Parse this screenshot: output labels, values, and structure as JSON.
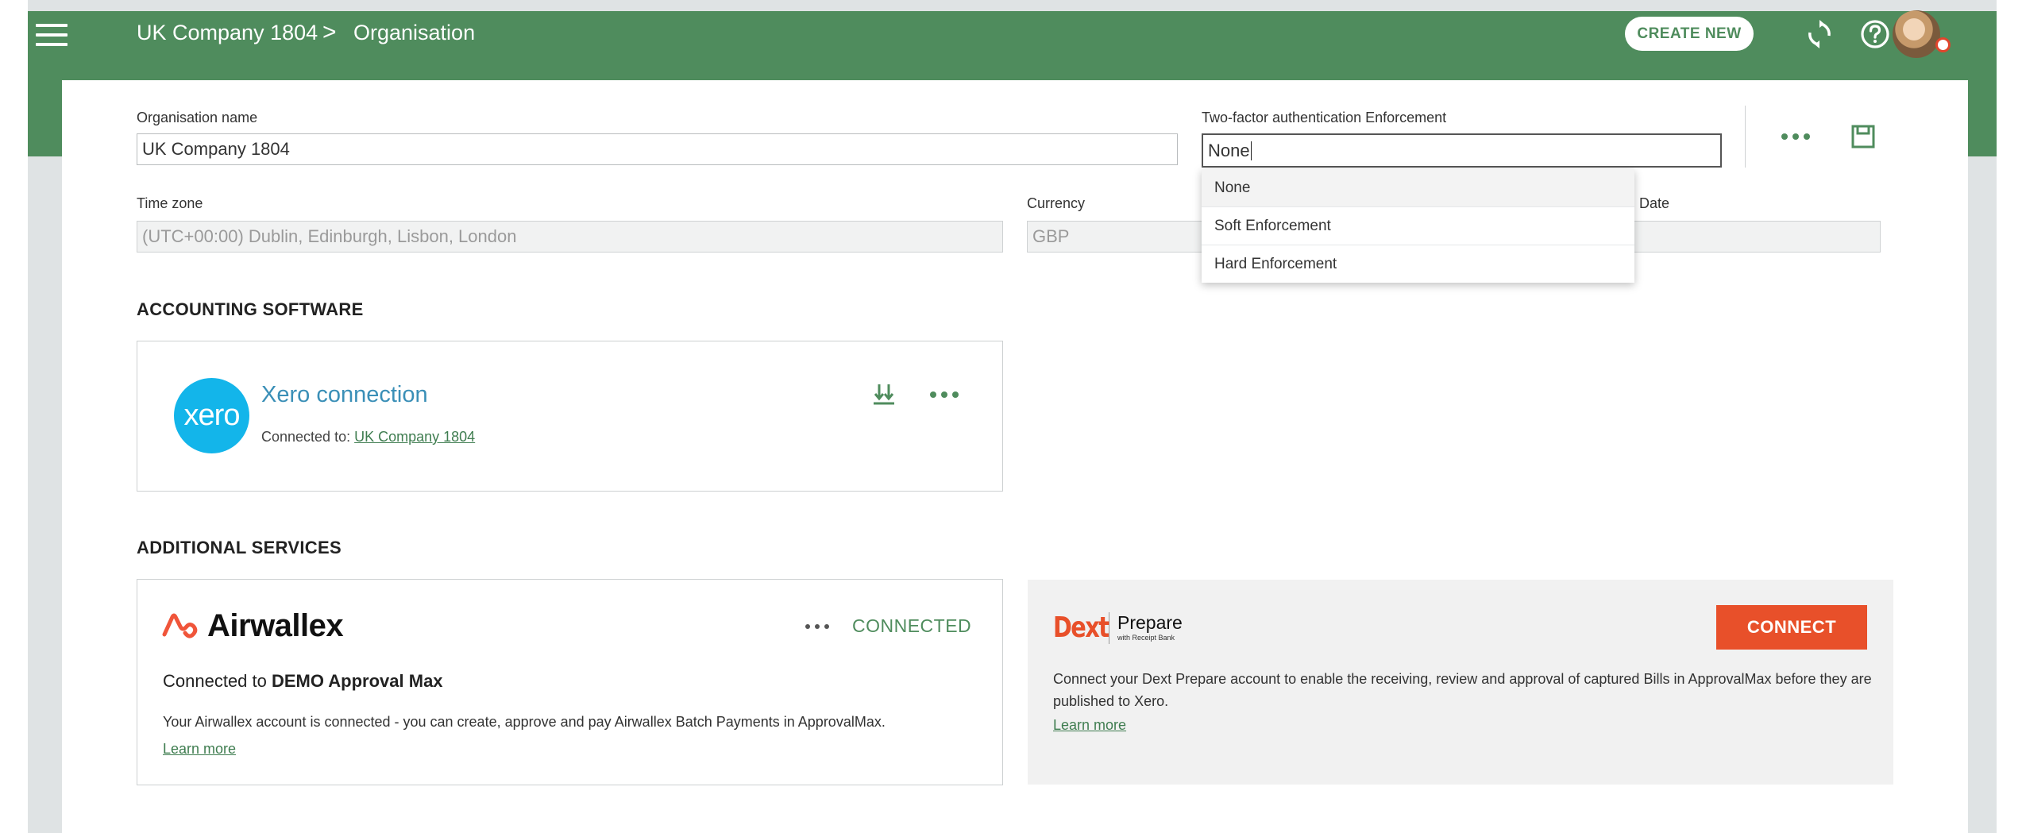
{
  "header": {
    "breadcrumb": [
      "UK Company 1804",
      "Organisation"
    ],
    "breadcrumb_separator": ">",
    "create_new_label": "CREATE NEW"
  },
  "form": {
    "org_name_label": "Organisation name",
    "org_name_value": "UK Company 1804",
    "tfa_label": "Two-factor authentication Enforcement",
    "tfa_value": "None",
    "tfa_options": [
      "None",
      "Soft Enforcement",
      "Hard Enforcement"
    ],
    "timezone_label": "Time zone",
    "timezone_value": "(UTC+00:00) Dublin, Edinburgh, Lisbon, London",
    "currency_label": "Currency",
    "currency_value": "GBP",
    "date_label_visible": ": Date",
    "date_value": ""
  },
  "accounting": {
    "section_title": "ACCOUNTING SOFTWARE",
    "logo_text": "xero",
    "title": "Xero connection",
    "connected_prefix": "Connected to: ",
    "connected_company": "UK Company 1804"
  },
  "services": {
    "section_title": "ADDITIONAL SERVICES",
    "airwallex": {
      "logo_text": "Airwallex",
      "status": "CONNECTED",
      "connected_prefix": "Connected to ",
      "connected_name": "DEMO Approval Max",
      "description": "Your Airwallex account is connected - you can create, approve and pay Airwallex Batch Payments in ApprovalMax.",
      "learn_more": "Learn more"
    },
    "dext": {
      "logo_text": "Dext",
      "product": "Prepare",
      "product_sub": "with Receipt Bank",
      "connect_label": "CONNECT",
      "description": "Connect your Dext Prepare account to enable the receiving, review and approval of captured Bills in ApprovalMax before they are published to Xero.",
      "learn_more": "Learn more"
    }
  },
  "colors": {
    "brand_green": "#4f8c5d",
    "dext_orange": "#e8502a",
    "xero_blue": "#13b5ea"
  }
}
